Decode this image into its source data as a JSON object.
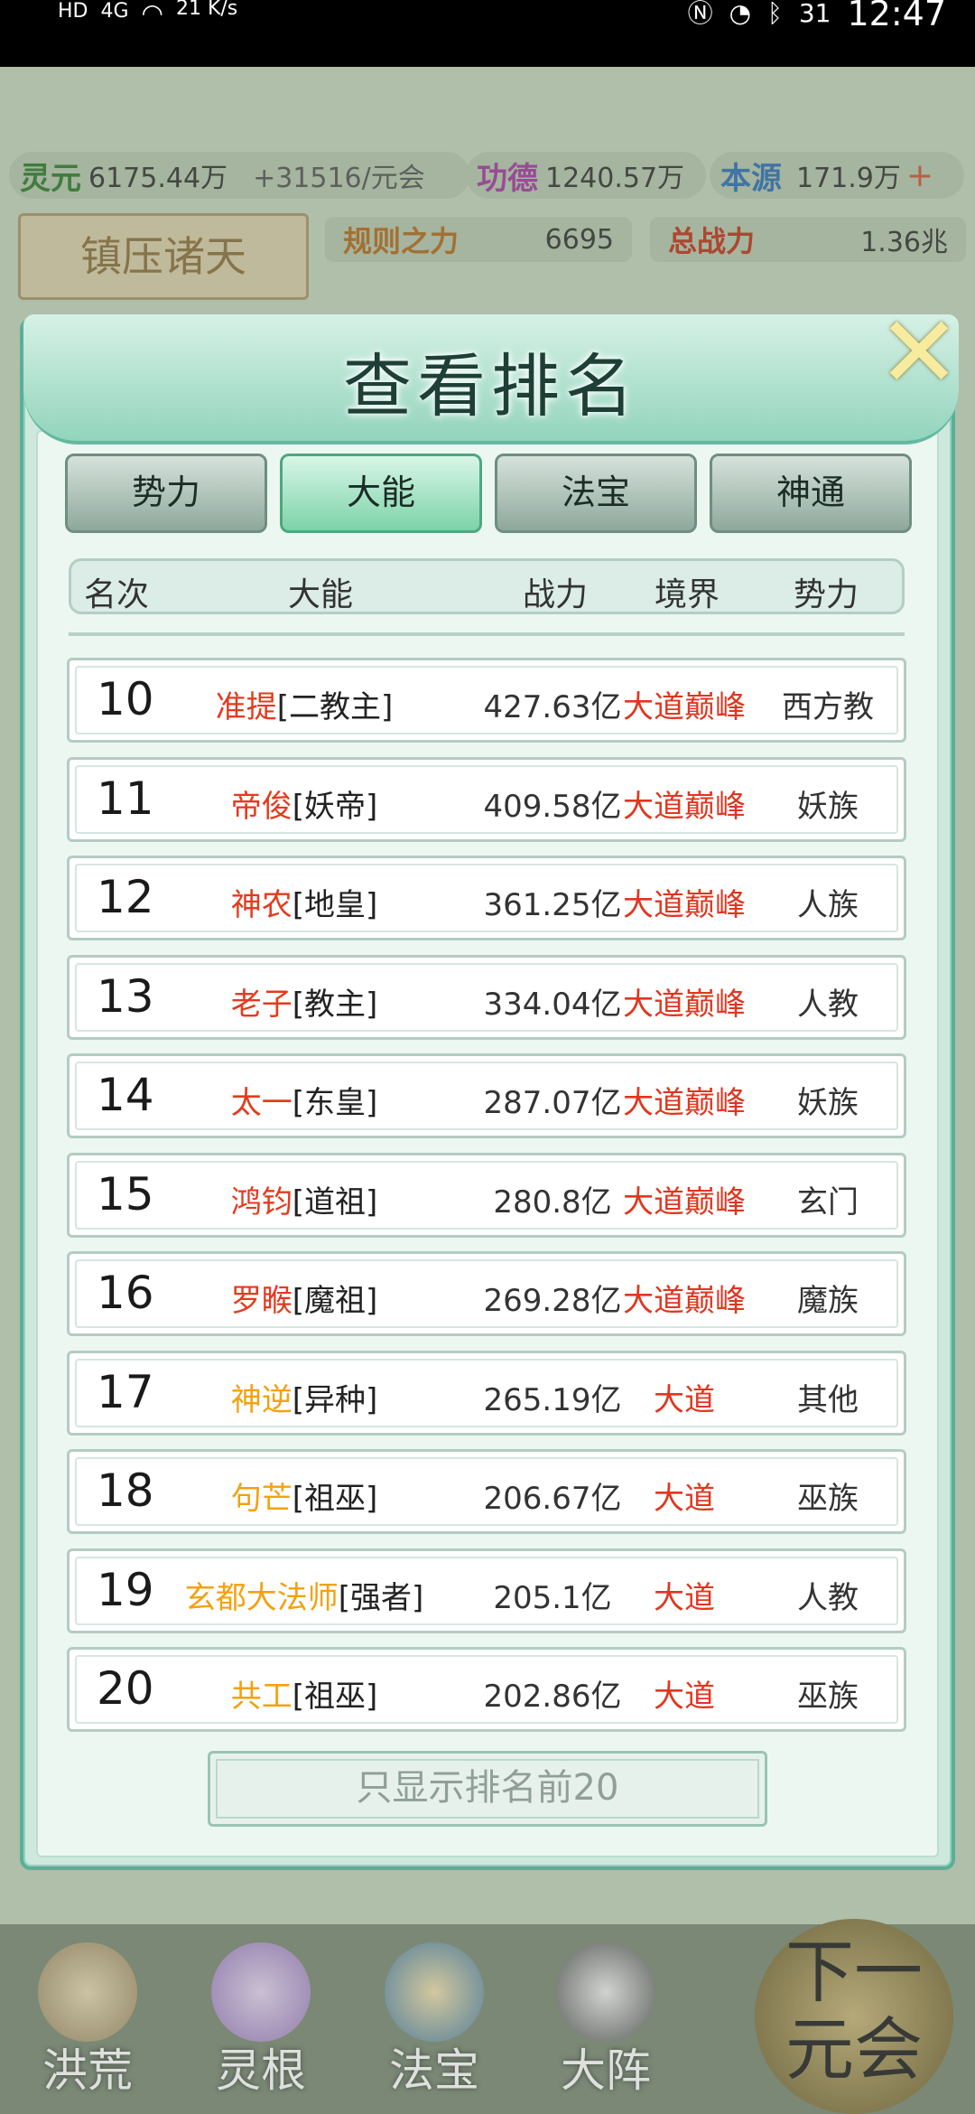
{
  "status_bar": {
    "left_text": "HD",
    "signal": "4G",
    "speed": "21 K/s",
    "time": "12:47",
    "battery": "31"
  },
  "resources": {
    "lingyuan_label": "灵元",
    "lingyuan_value": "6175.44万",
    "lingyuan_rate": "+31516/元会",
    "gongde_label": "功德",
    "gongde_value": "1240.57万",
    "benyuan_label": "本源",
    "benyuan_value": "171.9万"
  },
  "background": {
    "plaque": "镇压诸天",
    "rule_label": "规则之力",
    "rule_value": "6695",
    "total_label": "总战力",
    "total_value": "1.36兆"
  },
  "modal": {
    "title": "查看排名",
    "tabs": [
      "势力",
      "大能",
      "法宝",
      "神通"
    ],
    "active_tab": 1,
    "columns": [
      "名次",
      "大能",
      "战力",
      "境界",
      "势力"
    ],
    "rows": [
      {
        "rank": "10",
        "name": "准提",
        "title": "[二教主]",
        "power": "427.63亿",
        "realm": "大道巅峰",
        "faction": "西方教",
        "color": "red"
      },
      {
        "rank": "11",
        "name": "帝俊",
        "title": "[妖帝]",
        "power": "409.58亿",
        "realm": "大道巅峰",
        "faction": "妖族",
        "color": "red"
      },
      {
        "rank": "12",
        "name": "神农",
        "title": "[地皇]",
        "power": "361.25亿",
        "realm": "大道巅峰",
        "faction": "人族",
        "color": "red"
      },
      {
        "rank": "13",
        "name": "老子",
        "title": "[教主]",
        "power": "334.04亿",
        "realm": "大道巅峰",
        "faction": "人教",
        "color": "red"
      },
      {
        "rank": "14",
        "name": "太一",
        "title": "[东皇]",
        "power": "287.07亿",
        "realm": "大道巅峰",
        "faction": "妖族",
        "color": "red"
      },
      {
        "rank": "15",
        "name": "鸿钧",
        "title": "[道祖]",
        "power": "280.8亿",
        "realm": "大道巅峰",
        "faction": "玄门",
        "color": "red"
      },
      {
        "rank": "16",
        "name": "罗睺",
        "title": "[魔祖]",
        "power": "269.28亿",
        "realm": "大道巅峰",
        "faction": "魔族",
        "color": "red"
      },
      {
        "rank": "17",
        "name": "神逆",
        "title": "[异种]",
        "power": "265.19亿",
        "realm": "大道",
        "faction": "其他",
        "color": "gold"
      },
      {
        "rank": "18",
        "name": "句芒",
        "title": "[祖巫]",
        "power": "206.67亿",
        "realm": "大道",
        "faction": "巫族",
        "color": "gold"
      },
      {
        "rank": "19",
        "name": "玄都大法师",
        "title": "[强者]",
        "power": "205.1亿",
        "realm": "大道",
        "faction": "人教",
        "color": "gold"
      },
      {
        "rank": "20",
        "name": "共工",
        "title": "[祖巫]",
        "power": "202.86亿",
        "realm": "大道",
        "faction": "巫族",
        "color": "gold"
      }
    ],
    "footer_button": "只显示排名前20"
  },
  "bottom_nav": {
    "items": [
      "洪荒",
      "灵根",
      "法宝",
      "大阵"
    ],
    "next_button": "下一元会"
  },
  "colors": {
    "accent_red": "#e43a1d",
    "accent_gold": "#f3a10f",
    "modal_border": "#5aaf97"
  }
}
